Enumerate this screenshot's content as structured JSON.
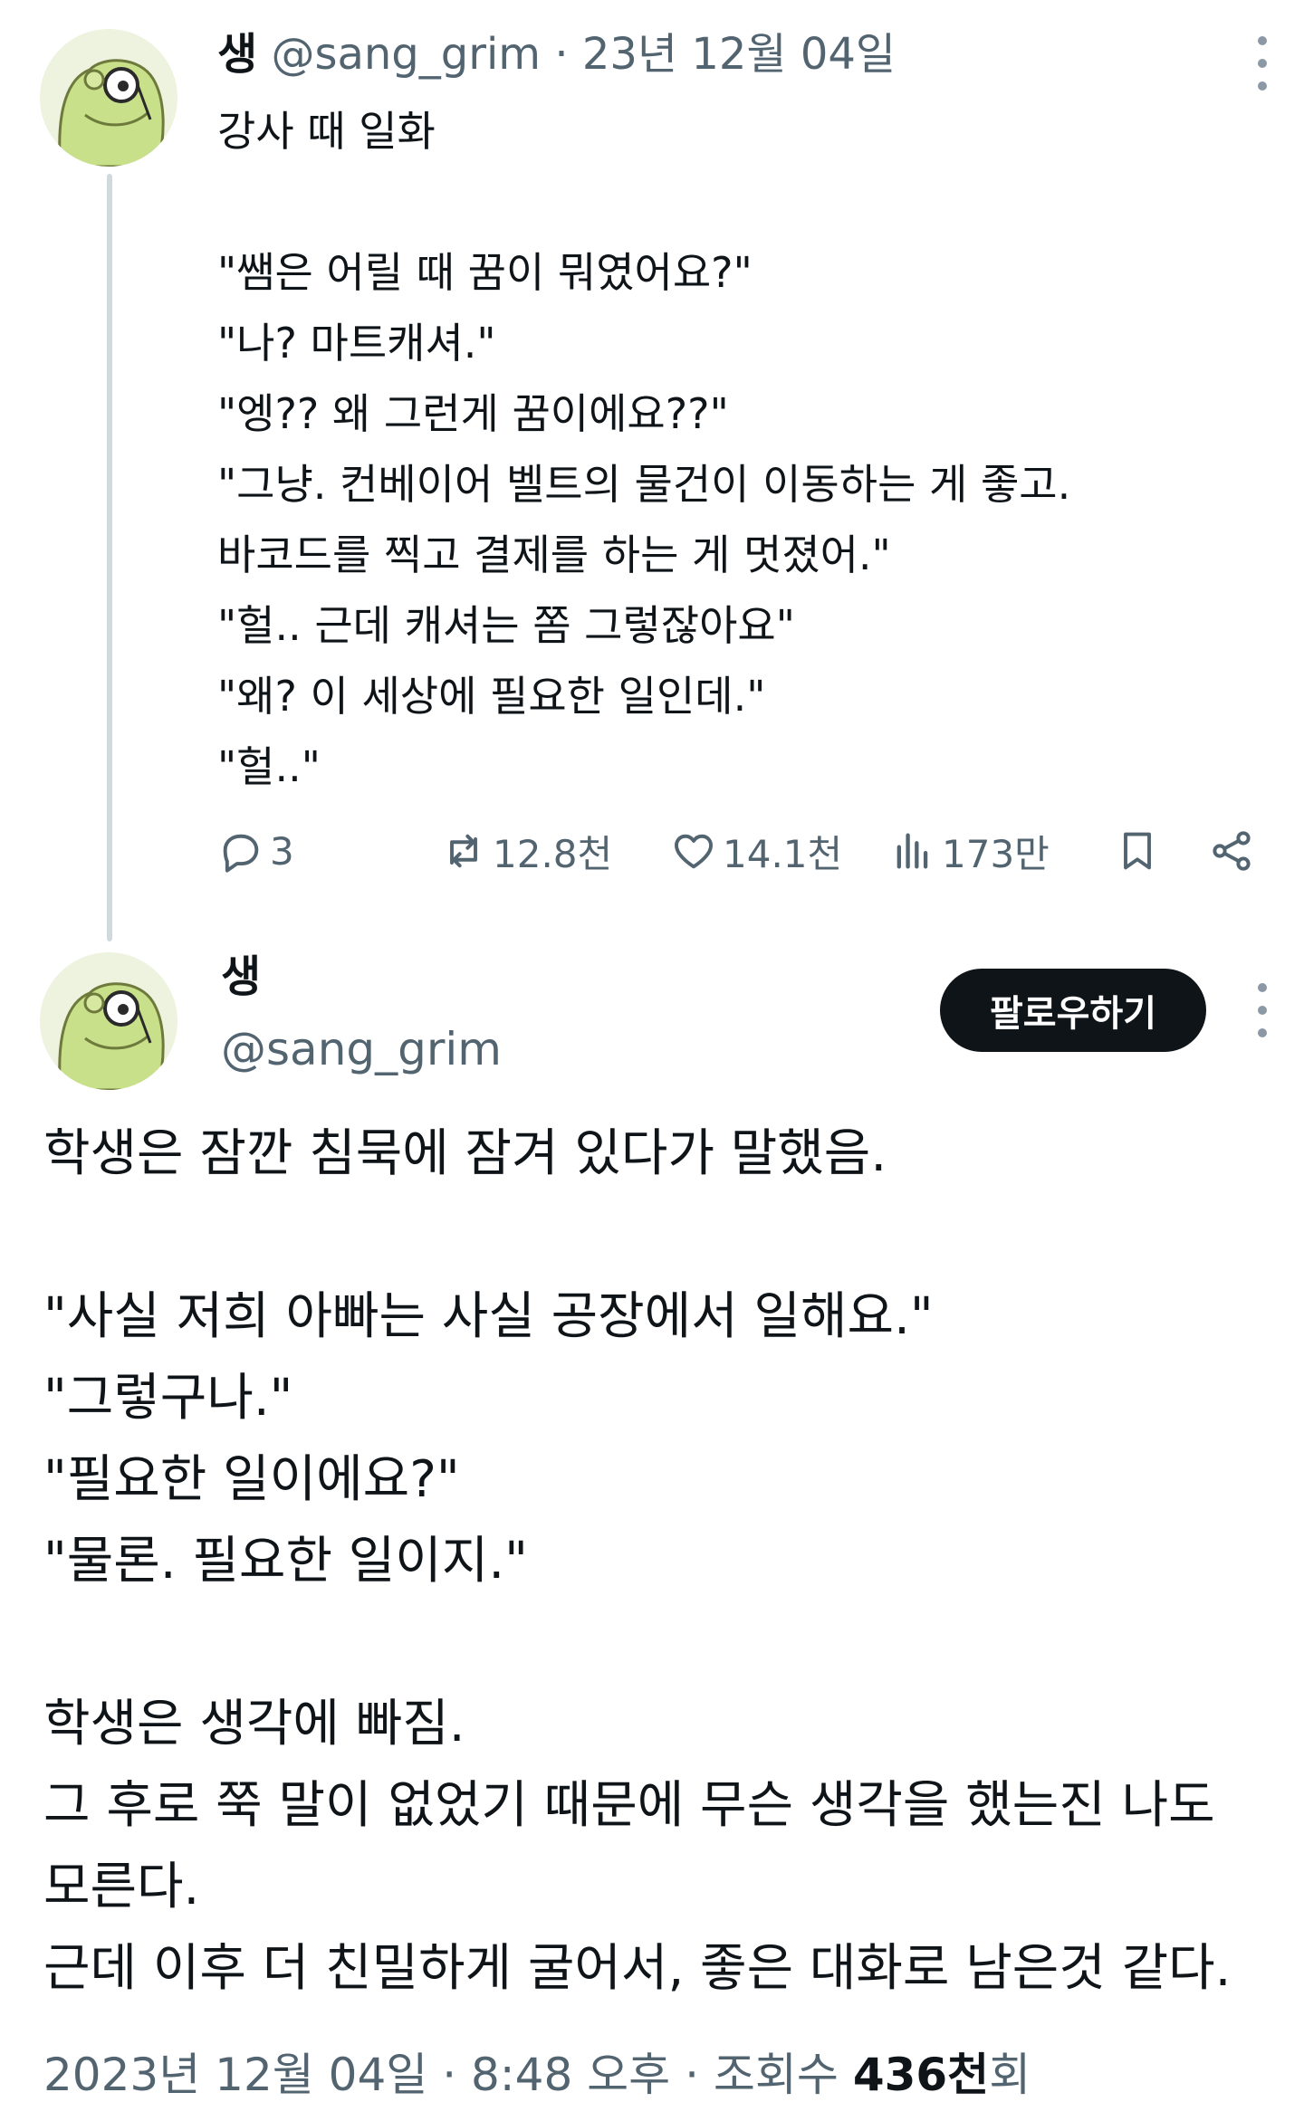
{
  "reply_tweet": {
    "author_name": "생",
    "handle": "@sang_grim",
    "separator": "·",
    "date": "23년 12월 04일",
    "text": "강사 때 일화\n\n\"쌤은 어릴 때 꿈이 뭐였어요?\"\n\"나? 마트캐셔.\"\n\"엥?? 왜 그런게 꿈이에요??\"\n\"그냥. 컨베이어 벨트의 물건이 이동하는 게 좋고.\n바코드를 찍고 결제를 하는 게 멋졌어.\"\n\"헐.. 근데 캐셔는 쫌 그렇잖아요\"\n\"왜? 이 세상에 필요한 일인데.\"\n\"헐..\"",
    "actions": {
      "replies": "3",
      "retweets": "12.8천",
      "likes": "14.1천",
      "views": "173만"
    }
  },
  "main_tweet": {
    "author_name": "생",
    "handle": "@sang_grim",
    "follow_label": "팔로우하기",
    "text": "학생은 잠깐 침묵에 잠겨 있다가 말했음.\n\n\"사실 저희 아빠는 사실 공장에서 일해요.\"\n\"그렇구나.\"\n\"필요한 일이에요?\"\n\"물론. 필요한 일이지.\"\n\n학생은 생각에 빠짐.\n그 후로 쭉 말이 없었기 때문에 무슨 생각을 했는진 나도 모른다.\n근데 이후 더 친밀하게 굴어서, 좋은 대화로 남은것 같다.",
    "footer": {
      "date": "2023년 12월 04일",
      "sep1": "·",
      "time": "8:48 오후",
      "sep2": "·",
      "views_label": "조회수",
      "views_value": "436천",
      "views_suffix": "회"
    }
  },
  "icons": {
    "reply": "speech-bubble-icon",
    "retweet": "retweet-icon",
    "like": "heart-icon",
    "views": "bar-chart-icon",
    "bookmark": "bookmark-icon",
    "share": "share-icon",
    "more": "more-vertical-icon",
    "avatar": "frog-avatar"
  },
  "colors": {
    "text": "#0f1419",
    "muted": "#536471",
    "follow_bg": "#0f1419",
    "thread_line": "#cfd9de"
  }
}
